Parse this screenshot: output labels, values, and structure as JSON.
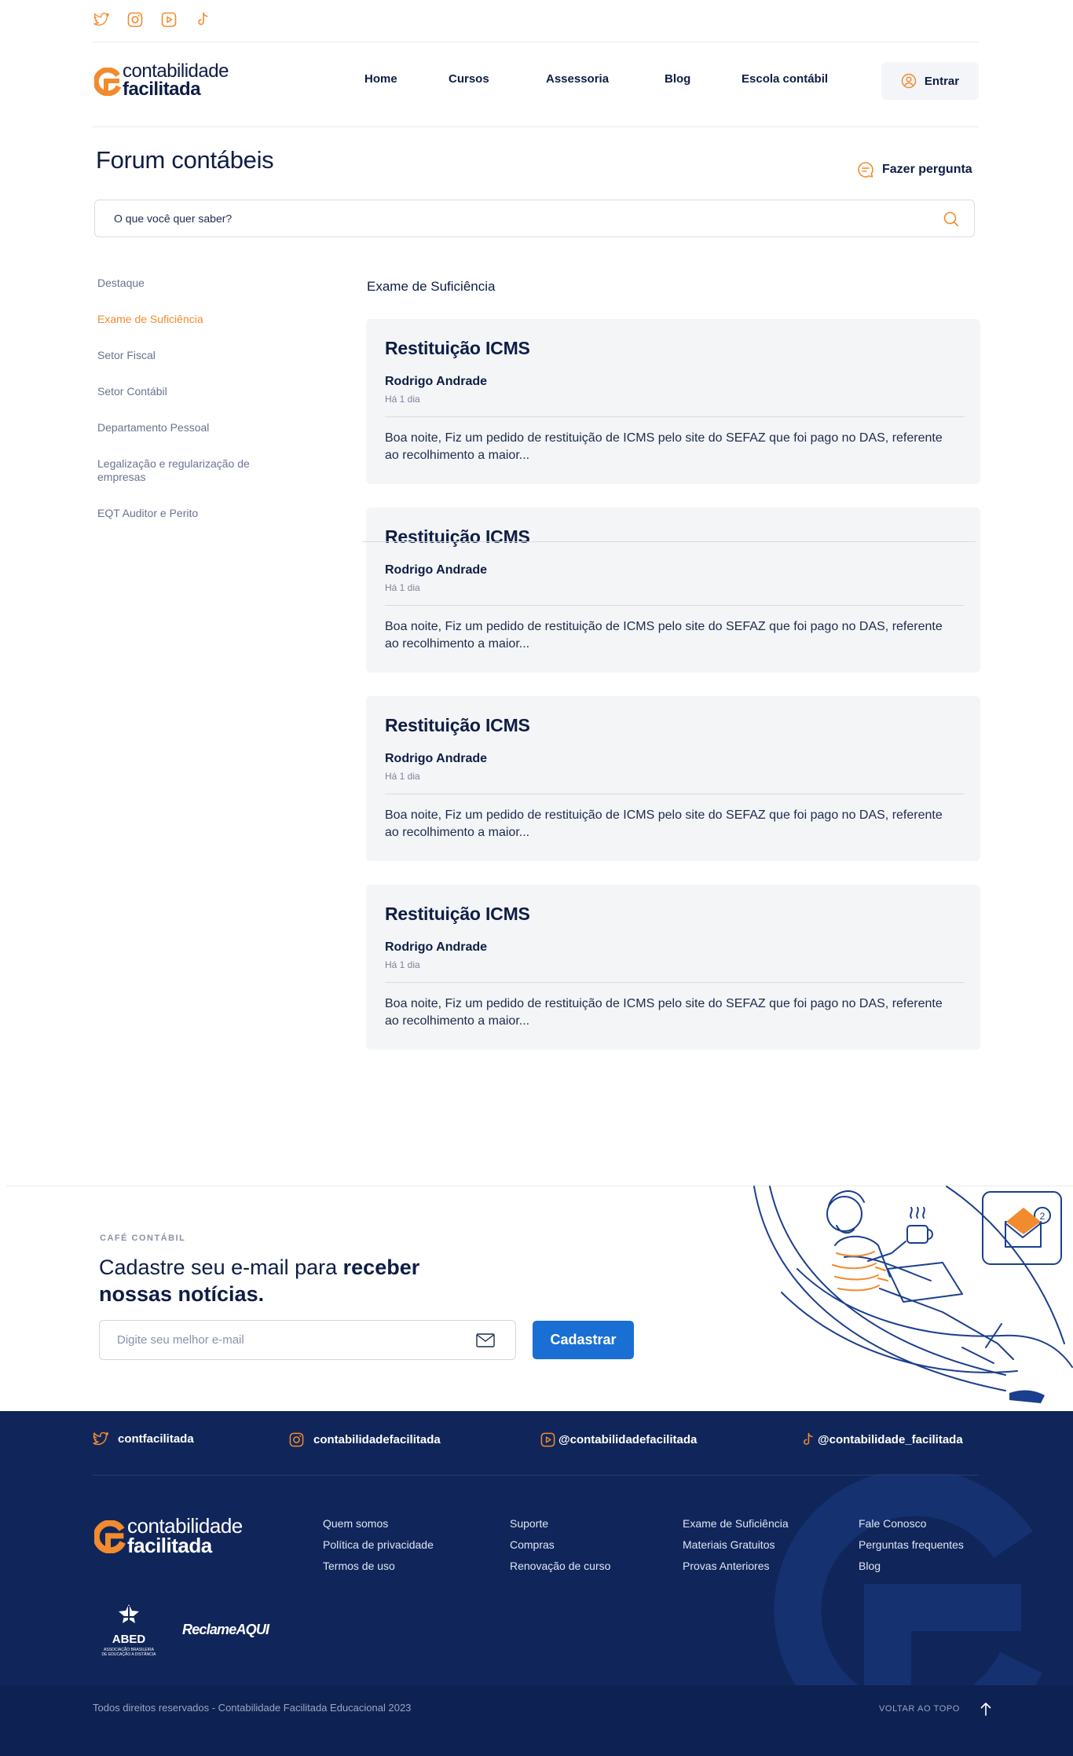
{
  "top_social": [
    "twitter-icon",
    "instagram-icon",
    "youtube-icon",
    "tiktok-icon"
  ],
  "logo": {
    "line1": "contabilidade",
    "line2": "facilitada"
  },
  "nav": {
    "items": [
      "Home",
      "Cursos",
      "Assessoria",
      "Blog",
      "Escola contábil"
    ],
    "login": "Entrar"
  },
  "page": {
    "title": "Forum contábeis",
    "ask": "Fazer pergunta"
  },
  "search": {
    "placeholder": "O que você quer saber?"
  },
  "sidebar": {
    "items": [
      {
        "label": "Destaque",
        "active": false
      },
      {
        "label": "Exame de Suficiência",
        "active": true
      },
      {
        "label": "Setor Fiscal",
        "active": false
      },
      {
        "label": "Setor Contábil",
        "active": false
      },
      {
        "label": "Departamento Pessoal",
        "active": false
      },
      {
        "label": "Legalização e regularização de empresas",
        "active": false
      },
      {
        "label": "EQT Auditor e Perito",
        "active": false
      }
    ]
  },
  "section": {
    "title": "Exame de Suficiência"
  },
  "posts": [
    {
      "title": "Restituição ICMS",
      "author": "Rodrigo Andrade",
      "time": "Há 1 dia",
      "excerpt": "Boa noite, Fiz um pedido de restituição de ICMS pelo site do SEFAZ que foi pago no DAS, referente ao recolhimento a maior..."
    },
    {
      "title": "Restituição ICMS",
      "author": "Rodrigo Andrade",
      "time": "Há 1 dia",
      "excerpt": "Boa noite, Fiz um pedido de restituição de ICMS pelo site do SEFAZ que foi pago no DAS, referente ao recolhimento a maior..."
    },
    {
      "title": "Restituição ICMS",
      "author": "Rodrigo Andrade",
      "time": "Há 1 dia",
      "excerpt": "Boa noite, Fiz um pedido de restituição de ICMS pelo site do SEFAZ que foi pago no DAS, referente ao recolhimento a maior..."
    },
    {
      "title": "Restituição ICMS",
      "author": "Rodrigo Andrade",
      "time": "Há 1 dia",
      "excerpt": "Boa noite, Fiz um pedido de restituição de ICMS pelo site do SEFAZ que foi pago no DAS, referente ao recolhimento a maior..."
    }
  ],
  "newsletter": {
    "kicker": "CAFÉ CONTÁBIL",
    "title_normal": "Cadastre seu e-mail para ",
    "title_bold_1": "receber",
    "title_bold_2": "nossas notícias.",
    "placeholder": "Digite seu melhor e-mail",
    "button": "Cadastrar",
    "badge_count": "2"
  },
  "footer": {
    "social": [
      {
        "icon": "twitter-icon",
        "handle": "contfacilitada"
      },
      {
        "icon": "instagram-icon",
        "handle": "contabilidadefacilitada"
      },
      {
        "icon": "youtube-icon",
        "handle": "@contabilidadefacilitada"
      },
      {
        "icon": "tiktok-icon",
        "handle": "@contabilidade_facilitada"
      }
    ],
    "columns": [
      [
        "Quem somos",
        "Política de privacidade",
        "Termos de uso"
      ],
      [
        "Suporte",
        "Compras",
        "Renovação de curso"
      ],
      [
        "Exame de Suficiência",
        "Materiais Gratuitos",
        "Provas Anteriores"
      ],
      [
        "Fale Conosco",
        "Perguntas frequentes",
        "Blog"
      ]
    ],
    "badges": {
      "abed": "ABED",
      "abed_sub1": "ASSOCIAÇÃO BRASILEIRA",
      "abed_sub2": "DE EDUCAÇÃO A DISTÂNCIA",
      "reclame": "ReclameAQUI"
    },
    "copyright": "Todos direitos reservados - Contabilidade Facilitada Educacional 2023",
    "back_to_top": "VOLTAR AO TOPO"
  },
  "colors": {
    "brand_orange": "#f28b2e",
    "navy": "#0f1d45",
    "footer_bg": "#10265a",
    "button_blue": "#1a6fd4"
  }
}
